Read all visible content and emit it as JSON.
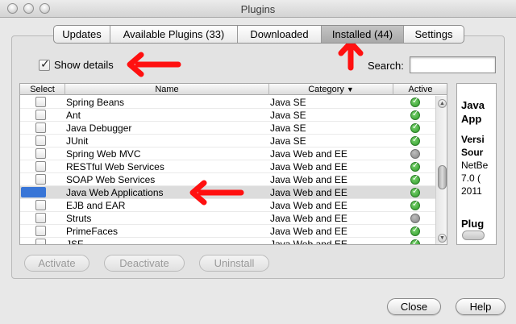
{
  "window": {
    "title": "Plugins"
  },
  "tabs": [
    {
      "label": "Updates",
      "selected": false
    },
    {
      "label": "Available Plugins (33)",
      "selected": false
    },
    {
      "label": "Downloaded",
      "selected": false
    },
    {
      "label": "Installed (44)",
      "selected": true
    },
    {
      "label": "Settings",
      "selected": false
    }
  ],
  "options": {
    "show_details_label": "Show details",
    "show_details_checked": true,
    "search_label": "Search:",
    "search_value": ""
  },
  "table": {
    "headers": {
      "select": "Select",
      "name": "Name",
      "category": "Category",
      "active": "Active"
    },
    "rows": [
      {
        "name": "Spring Beans",
        "category": "Java SE",
        "active": true,
        "selected": false
      },
      {
        "name": "Ant",
        "category": "Java SE",
        "active": true,
        "selected": false
      },
      {
        "name": "Java Debugger",
        "category": "Java SE",
        "active": true,
        "selected": false
      },
      {
        "name": "JUnit",
        "category": "Java SE",
        "active": true,
        "selected": false
      },
      {
        "name": "Spring Web MVC",
        "category": "Java Web and EE",
        "active": false,
        "selected": false
      },
      {
        "name": "RESTful Web Services",
        "category": "Java Web and EE",
        "active": true,
        "selected": false
      },
      {
        "name": "SOAP Web Services",
        "category": "Java Web and EE",
        "active": true,
        "selected": false
      },
      {
        "name": "Java Web Applications",
        "category": "Java Web and EE",
        "active": true,
        "selected": true
      },
      {
        "name": "EJB and EAR",
        "category": "Java Web and EE",
        "active": true,
        "selected": false
      },
      {
        "name": "Struts",
        "category": "Java Web and EE",
        "active": false,
        "selected": false
      },
      {
        "name": "PrimeFaces",
        "category": "Java Web and EE",
        "active": true,
        "selected": false
      },
      {
        "name": "JSF",
        "category": "Java Web and EE",
        "active": true,
        "selected": false
      }
    ]
  },
  "details": {
    "title_line1": "Java",
    "title_line2": "App",
    "version_label": "Versi",
    "source_label": "Sour",
    "source_value": "NetBe",
    "version_value": "7.0 (",
    "date_value": "2011",
    "section": "Plug"
  },
  "actions": {
    "activate": "Activate",
    "deactivate": "Deactivate",
    "uninstall": "Uninstall"
  },
  "footer": {
    "close": "Close",
    "help": "Help"
  },
  "colors": {
    "selection": "#3875d7",
    "arrow": "#ff1010",
    "active_status": "#2e9a2a",
    "inactive_status": "#848484"
  }
}
